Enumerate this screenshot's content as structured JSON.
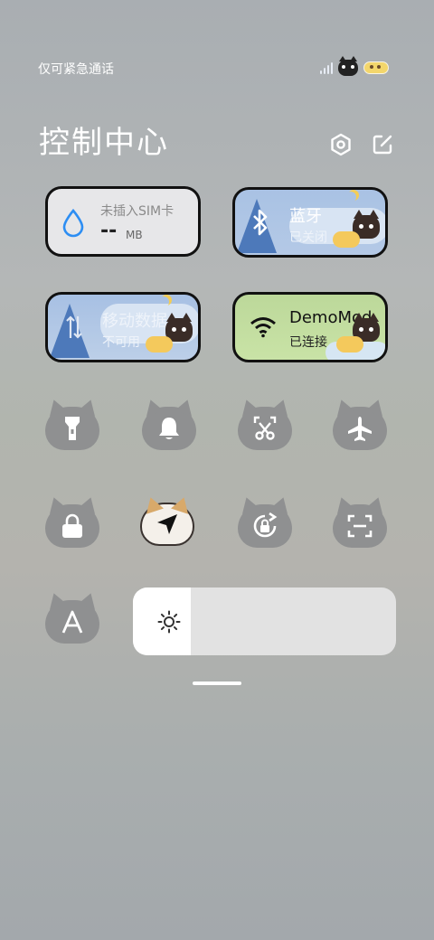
{
  "status_bar": {
    "text": "仅可紧急通话"
  },
  "header": {
    "title": "控制中心"
  },
  "tiles": {
    "sim": {
      "label": "未插入SIM卡",
      "value": "--",
      "unit": "MB"
    },
    "bluetooth": {
      "label": "蓝牙",
      "status": "已关闭"
    },
    "mobile_data": {
      "label": "移动数据",
      "status": "不可用"
    },
    "wifi": {
      "label": "DemoMod",
      "status": "已连接"
    }
  },
  "toggles": [
    {
      "name": "flashlight",
      "icon": "flashlight-icon",
      "on": false
    },
    {
      "name": "ringer",
      "icon": "bell-icon",
      "on": false
    },
    {
      "name": "screenshot",
      "icon": "scissors-icon",
      "on": false
    },
    {
      "name": "airplane",
      "icon": "airplane-icon",
      "on": false
    },
    {
      "name": "lock",
      "icon": "lock-icon",
      "on": false
    },
    {
      "name": "location",
      "icon": "location-arrow-icon",
      "on": true
    },
    {
      "name": "rotation-lock",
      "icon": "rotation-lock-icon",
      "on": false
    },
    {
      "name": "scan",
      "icon": "scan-icon",
      "on": false
    },
    {
      "name": "font",
      "icon": "font-a-icon",
      "on": false
    }
  ],
  "brightness": {
    "level": 0.22,
    "icon": "sun-icon"
  },
  "colors": {
    "toggle_off": "#8f9091",
    "tile_border": "#111111",
    "accent_blue": "#2d8ef3"
  }
}
